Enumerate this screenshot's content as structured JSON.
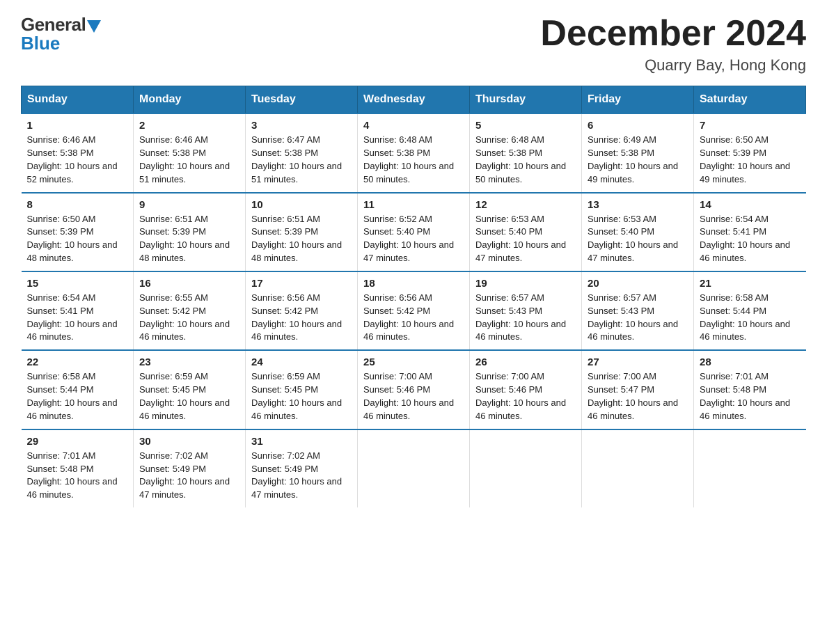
{
  "logo": {
    "general": "General",
    "blue": "Blue"
  },
  "title": "December 2024",
  "location": "Quarry Bay, Hong Kong",
  "weekdays": [
    "Sunday",
    "Monday",
    "Tuesday",
    "Wednesday",
    "Thursday",
    "Friday",
    "Saturday"
  ],
  "weeks": [
    [
      {
        "day": "1",
        "sunrise": "Sunrise: 6:46 AM",
        "sunset": "Sunset: 5:38 PM",
        "daylight": "Daylight: 10 hours and 52 minutes."
      },
      {
        "day": "2",
        "sunrise": "Sunrise: 6:46 AM",
        "sunset": "Sunset: 5:38 PM",
        "daylight": "Daylight: 10 hours and 51 minutes."
      },
      {
        "day": "3",
        "sunrise": "Sunrise: 6:47 AM",
        "sunset": "Sunset: 5:38 PM",
        "daylight": "Daylight: 10 hours and 51 minutes."
      },
      {
        "day": "4",
        "sunrise": "Sunrise: 6:48 AM",
        "sunset": "Sunset: 5:38 PM",
        "daylight": "Daylight: 10 hours and 50 minutes."
      },
      {
        "day": "5",
        "sunrise": "Sunrise: 6:48 AM",
        "sunset": "Sunset: 5:38 PM",
        "daylight": "Daylight: 10 hours and 50 minutes."
      },
      {
        "day": "6",
        "sunrise": "Sunrise: 6:49 AM",
        "sunset": "Sunset: 5:38 PM",
        "daylight": "Daylight: 10 hours and 49 minutes."
      },
      {
        "day": "7",
        "sunrise": "Sunrise: 6:50 AM",
        "sunset": "Sunset: 5:39 PM",
        "daylight": "Daylight: 10 hours and 49 minutes."
      }
    ],
    [
      {
        "day": "8",
        "sunrise": "Sunrise: 6:50 AM",
        "sunset": "Sunset: 5:39 PM",
        "daylight": "Daylight: 10 hours and 48 minutes."
      },
      {
        "day": "9",
        "sunrise": "Sunrise: 6:51 AM",
        "sunset": "Sunset: 5:39 PM",
        "daylight": "Daylight: 10 hours and 48 minutes."
      },
      {
        "day": "10",
        "sunrise": "Sunrise: 6:51 AM",
        "sunset": "Sunset: 5:39 PM",
        "daylight": "Daylight: 10 hours and 48 minutes."
      },
      {
        "day": "11",
        "sunrise": "Sunrise: 6:52 AM",
        "sunset": "Sunset: 5:40 PM",
        "daylight": "Daylight: 10 hours and 47 minutes."
      },
      {
        "day": "12",
        "sunrise": "Sunrise: 6:53 AM",
        "sunset": "Sunset: 5:40 PM",
        "daylight": "Daylight: 10 hours and 47 minutes."
      },
      {
        "day": "13",
        "sunrise": "Sunrise: 6:53 AM",
        "sunset": "Sunset: 5:40 PM",
        "daylight": "Daylight: 10 hours and 47 minutes."
      },
      {
        "day": "14",
        "sunrise": "Sunrise: 6:54 AM",
        "sunset": "Sunset: 5:41 PM",
        "daylight": "Daylight: 10 hours and 46 minutes."
      }
    ],
    [
      {
        "day": "15",
        "sunrise": "Sunrise: 6:54 AM",
        "sunset": "Sunset: 5:41 PM",
        "daylight": "Daylight: 10 hours and 46 minutes."
      },
      {
        "day": "16",
        "sunrise": "Sunrise: 6:55 AM",
        "sunset": "Sunset: 5:42 PM",
        "daylight": "Daylight: 10 hours and 46 minutes."
      },
      {
        "day": "17",
        "sunrise": "Sunrise: 6:56 AM",
        "sunset": "Sunset: 5:42 PM",
        "daylight": "Daylight: 10 hours and 46 minutes."
      },
      {
        "day": "18",
        "sunrise": "Sunrise: 6:56 AM",
        "sunset": "Sunset: 5:42 PM",
        "daylight": "Daylight: 10 hours and 46 minutes."
      },
      {
        "day": "19",
        "sunrise": "Sunrise: 6:57 AM",
        "sunset": "Sunset: 5:43 PM",
        "daylight": "Daylight: 10 hours and 46 minutes."
      },
      {
        "day": "20",
        "sunrise": "Sunrise: 6:57 AM",
        "sunset": "Sunset: 5:43 PM",
        "daylight": "Daylight: 10 hours and 46 minutes."
      },
      {
        "day": "21",
        "sunrise": "Sunrise: 6:58 AM",
        "sunset": "Sunset: 5:44 PM",
        "daylight": "Daylight: 10 hours and 46 minutes."
      }
    ],
    [
      {
        "day": "22",
        "sunrise": "Sunrise: 6:58 AM",
        "sunset": "Sunset: 5:44 PM",
        "daylight": "Daylight: 10 hours and 46 minutes."
      },
      {
        "day": "23",
        "sunrise": "Sunrise: 6:59 AM",
        "sunset": "Sunset: 5:45 PM",
        "daylight": "Daylight: 10 hours and 46 minutes."
      },
      {
        "day": "24",
        "sunrise": "Sunrise: 6:59 AM",
        "sunset": "Sunset: 5:45 PM",
        "daylight": "Daylight: 10 hours and 46 minutes."
      },
      {
        "day": "25",
        "sunrise": "Sunrise: 7:00 AM",
        "sunset": "Sunset: 5:46 PM",
        "daylight": "Daylight: 10 hours and 46 minutes."
      },
      {
        "day": "26",
        "sunrise": "Sunrise: 7:00 AM",
        "sunset": "Sunset: 5:46 PM",
        "daylight": "Daylight: 10 hours and 46 minutes."
      },
      {
        "day": "27",
        "sunrise": "Sunrise: 7:00 AM",
        "sunset": "Sunset: 5:47 PM",
        "daylight": "Daylight: 10 hours and 46 minutes."
      },
      {
        "day": "28",
        "sunrise": "Sunrise: 7:01 AM",
        "sunset": "Sunset: 5:48 PM",
        "daylight": "Daylight: 10 hours and 46 minutes."
      }
    ],
    [
      {
        "day": "29",
        "sunrise": "Sunrise: 7:01 AM",
        "sunset": "Sunset: 5:48 PM",
        "daylight": "Daylight: 10 hours and 46 minutes."
      },
      {
        "day": "30",
        "sunrise": "Sunrise: 7:02 AM",
        "sunset": "Sunset: 5:49 PM",
        "daylight": "Daylight: 10 hours and 47 minutes."
      },
      {
        "day": "31",
        "sunrise": "Sunrise: 7:02 AM",
        "sunset": "Sunset: 5:49 PM",
        "daylight": "Daylight: 10 hours and 47 minutes."
      },
      {
        "day": "",
        "sunrise": "",
        "sunset": "",
        "daylight": ""
      },
      {
        "day": "",
        "sunrise": "",
        "sunset": "",
        "daylight": ""
      },
      {
        "day": "",
        "sunrise": "",
        "sunset": "",
        "daylight": ""
      },
      {
        "day": "",
        "sunrise": "",
        "sunset": "",
        "daylight": ""
      }
    ]
  ]
}
